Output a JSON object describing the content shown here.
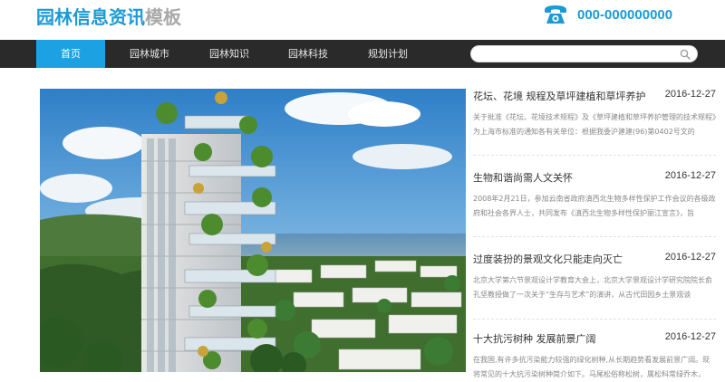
{
  "header": {
    "logo_primary": "园林信息资讯",
    "logo_secondary": "模板",
    "phone": "000-000000000",
    "phone_icon": "phone-icon",
    "colors": {
      "brand": "#1b9ad6",
      "logo_secondary": "#a9a9a9"
    }
  },
  "nav": {
    "items": [
      {
        "label": "首页",
        "active": true
      },
      {
        "label": "园林城市",
        "active": false
      },
      {
        "label": "园林知识",
        "active": false
      },
      {
        "label": "园林科技",
        "active": false
      },
      {
        "label": "规划计划",
        "active": false
      }
    ],
    "search": {
      "placeholder": "",
      "value": "",
      "icon": "search-icon"
    },
    "colors": {
      "bar": "#2a2a2a",
      "active": "#1ca1e2"
    }
  },
  "hero": {
    "alt": "building-render"
  },
  "news": [
    {
      "title": "花坛、花境 规程及草坪建植和草坪养护...",
      "date": "2016-12-27",
      "summary": "关于批准《花坛、花境技术规程》及《草坪建植和草坪养护管理的技术规程》为上海市标准的通知各有关单位：根据我委沪建建(96)第0402号文的"
    },
    {
      "title": "生物和谐尚需人文关怀",
      "date": "2016-12-27",
      "summary": "2008年2月21日，参加云南省政府滇西北生物多样性保护工作会议的各级政府和社会各界人士，共同发布《滇西北生物多样性保护丽江宣言》，旨"
    },
    {
      "title": "过度装扮的景观文化只能走向灭亡",
      "date": "2016-12-27",
      "summary": "北京大学第六节景观设计学教育大会上，北京大学景观设计学研究院院长俞孔坚教授做了一次关于“生存与艺术”的演讲，从古代田园乡土景观谈"
    },
    {
      "title": "十大抗污树种 发展前景广阔",
      "date": "2016-12-27",
      "summary": "在我国,有许多抗污染能力较强的绿化树种,从长期趋势看发展前景广阔。现将常见的十大抗污染树种简介如下。马尾松俗称松树，属松科常绿乔木，"
    }
  ]
}
